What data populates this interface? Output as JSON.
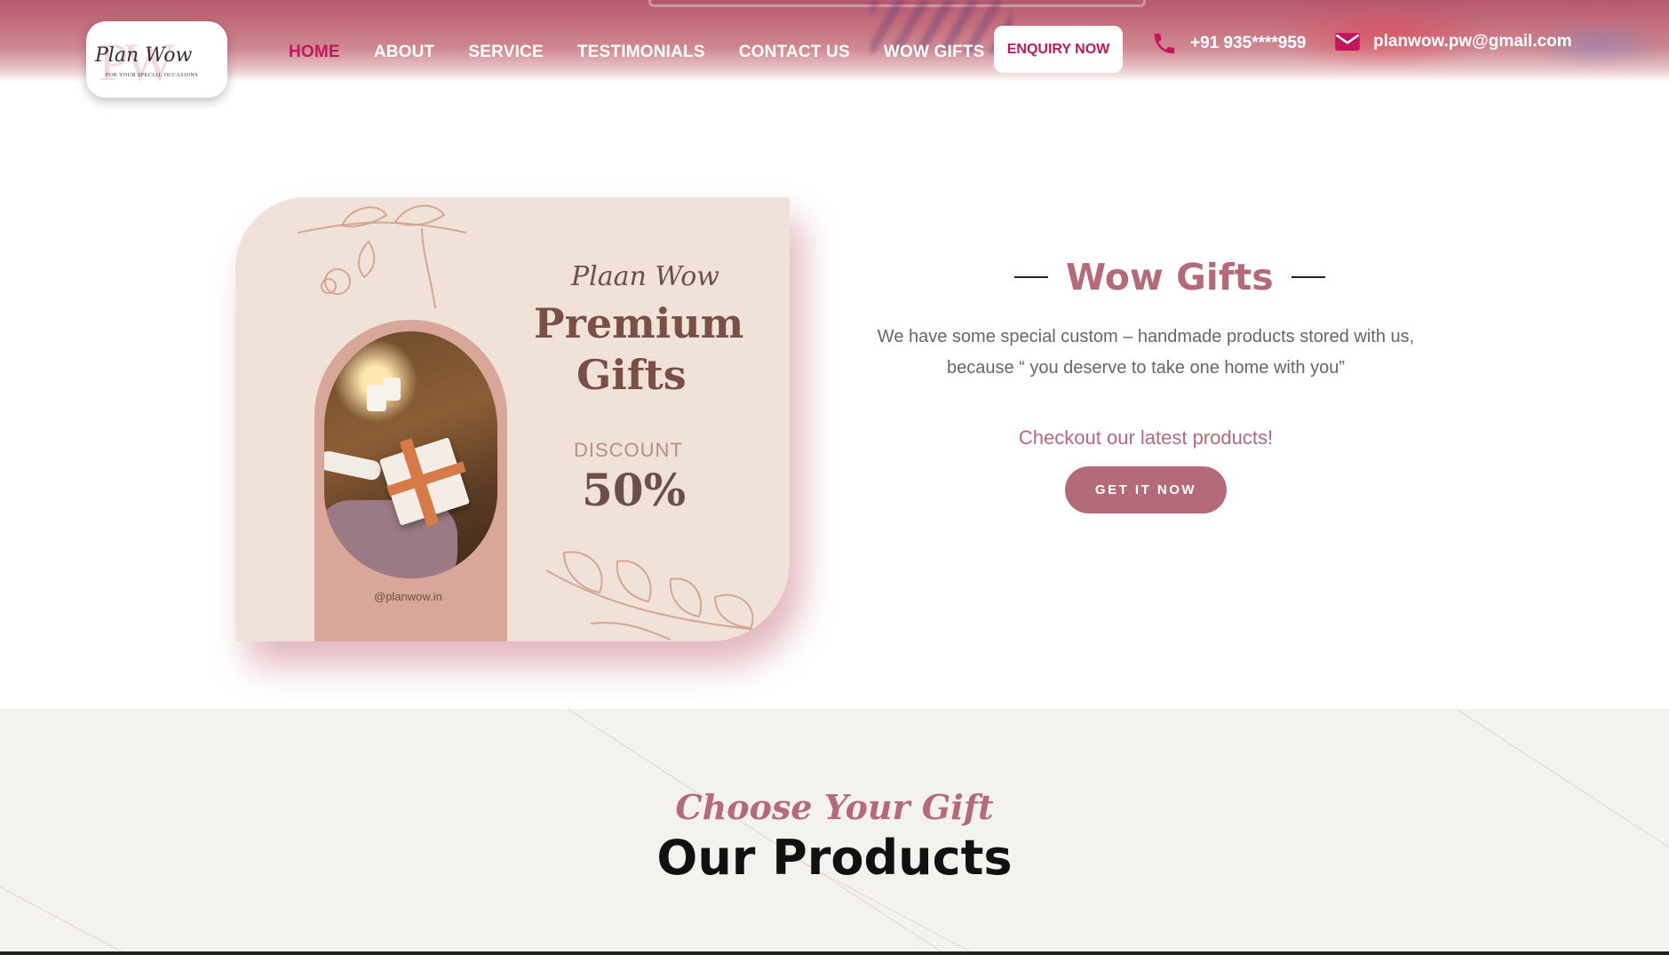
{
  "header": {
    "logo": {
      "monogram": "PW",
      "script": "Plan Wow",
      "tagline": "FOR YOUR SPECIAL OCCASIONS"
    },
    "nav": [
      {
        "label": "HOME",
        "active": true
      },
      {
        "label": "ABOUT",
        "active": false
      },
      {
        "label": "SERVICE",
        "active": false
      },
      {
        "label": "TESTIMONIALS",
        "active": false
      },
      {
        "label": "CONTACT US",
        "active": false
      },
      {
        "label": "WOW GIFTS",
        "active": false
      }
    ],
    "enquiry_label": "ENQUIRY NOW",
    "phone": {
      "icon": "phone-icon",
      "text": "+91 935****959"
    },
    "email": {
      "icon": "mail-icon",
      "text": "planwow.pw@gmail.com"
    }
  },
  "promo": {
    "brand_script": "Plaan Wow",
    "title_line1": "Premium",
    "title_line2": "Gifts",
    "discount_label": "DISCOUNT",
    "discount_value": "50%",
    "handle": "@planwow.in"
  },
  "wow_gifts": {
    "title": "Wow Gifts",
    "description": "We have some special custom – handmade products stored with us, because “ you deserve to take one home with you”",
    "checkout_text": "Checkout our latest products!",
    "button_label": "GET IT NOW"
  },
  "products": {
    "kicker": "Choose Your Gift",
    "heading": "Our Products"
  },
  "colors": {
    "accent": "#b46a78",
    "nav_active": "#c2185b",
    "promo_bg": "#f0e2d9",
    "section_bg": "#f4f2ef"
  }
}
